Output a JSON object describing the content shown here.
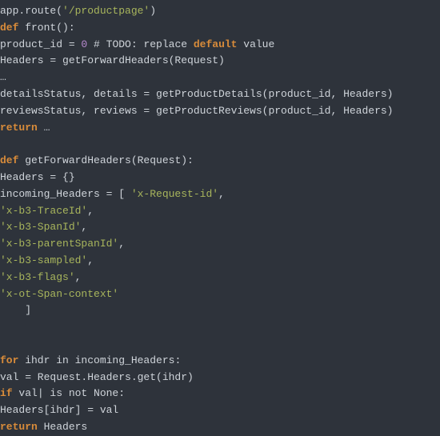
{
  "code": {
    "l01_a": "app.route(",
    "l01_b": "'/productpage'",
    "l01_c": ")",
    "l02_a": "def",
    "l02_b": " front():",
    "l03_a": "product_id = ",
    "l03_b": "0",
    "l03_c": " # TODO: replace ",
    "l03_d": "default",
    "l03_e": " value",
    "l04": "Headers = getForwardHeaders(Request)",
    "l05": "…",
    "l06": "detailsStatus, details = getProductDetails(product_id, Headers)",
    "l07": "reviewsStatus, reviews = getProductReviews(product_id, Headers)",
    "l08_a": "return",
    "l08_b": " …",
    "l09": "",
    "l10_a": "def",
    "l10_b": " getForwardHeaders(Request):",
    "l11": "Headers = {}",
    "l12_a": "incoming_Headers = [ ",
    "l12_b": "'x-Request-id'",
    "l12_c": ",",
    "l13_a": "'x-b3-TraceId'",
    "l13_b": ",",
    "l14_a": "'x-b3-SpanId'",
    "l14_b": ",",
    "l15_a": "'x-b3-parentSpanId'",
    "l15_b": ",",
    "l16_a": "'x-b3-sampled'",
    "l16_b": ",",
    "l17_a": "'x-b3-flags'",
    "l17_b": ",",
    "l18": "'x-ot-Span-context'",
    "l19": "    ]",
    "l20": "",
    "l21": "",
    "l22_a": "for",
    "l22_b": " ihdr in incoming_Headers:",
    "l23": "val = Request.Headers.get(ihdr)",
    "l24_a": "if",
    "l24_b": " val| is not None:",
    "l25": "Headers[ihdr] = val",
    "l26_a": "return",
    "l26_b": " Headers"
  }
}
